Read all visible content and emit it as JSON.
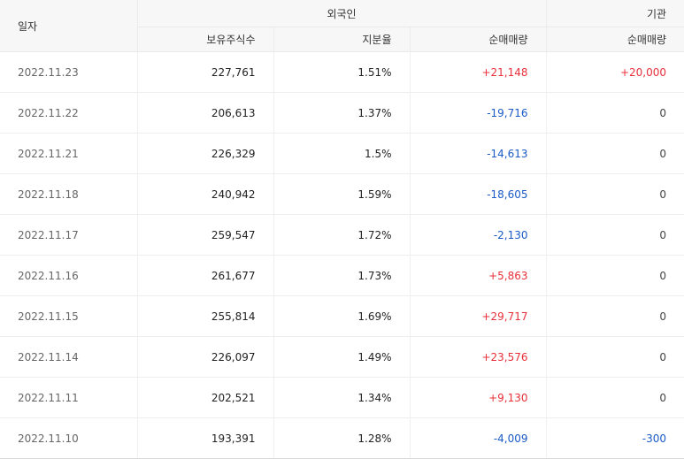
{
  "header": {
    "date": "일자",
    "foreign": "외국인",
    "institution": "기관",
    "holdings": "보유주식수",
    "share_ratio": "지분율",
    "foreign_net": "순매매량",
    "inst_net": "순매매량"
  },
  "colors": {
    "up": "#e8303a",
    "down": "#1a5bc6"
  },
  "rows": [
    {
      "date": "2022.11.23",
      "holdings": "227,761",
      "ratio": "1.51%",
      "foreign_net": "+21,148",
      "foreign_dir": "up",
      "inst_net": "+20,000",
      "inst_dir": "up"
    },
    {
      "date": "2022.11.22",
      "holdings": "206,613",
      "ratio": "1.37%",
      "foreign_net": "-19,716",
      "foreign_dir": "down",
      "inst_net": "0",
      "inst_dir": "zero"
    },
    {
      "date": "2022.11.21",
      "holdings": "226,329",
      "ratio": "1.5%",
      "foreign_net": "-14,613",
      "foreign_dir": "down",
      "inst_net": "0",
      "inst_dir": "zero"
    },
    {
      "date": "2022.11.18",
      "holdings": "240,942",
      "ratio": "1.59%",
      "foreign_net": "-18,605",
      "foreign_dir": "down",
      "inst_net": "0",
      "inst_dir": "zero"
    },
    {
      "date": "2022.11.17",
      "holdings": "259,547",
      "ratio": "1.72%",
      "foreign_net": "-2,130",
      "foreign_dir": "down",
      "inst_net": "0",
      "inst_dir": "zero"
    },
    {
      "date": "2022.11.16",
      "holdings": "261,677",
      "ratio": "1.73%",
      "foreign_net": "+5,863",
      "foreign_dir": "up",
      "inst_net": "0",
      "inst_dir": "zero"
    },
    {
      "date": "2022.11.15",
      "holdings": "255,814",
      "ratio": "1.69%",
      "foreign_net": "+29,717",
      "foreign_dir": "up",
      "inst_net": "0",
      "inst_dir": "zero"
    },
    {
      "date": "2022.11.14",
      "holdings": "226,097",
      "ratio": "1.49%",
      "foreign_net": "+23,576",
      "foreign_dir": "up",
      "inst_net": "0",
      "inst_dir": "zero"
    },
    {
      "date": "2022.11.11",
      "holdings": "202,521",
      "ratio": "1.34%",
      "foreign_net": "+9,130",
      "foreign_dir": "up",
      "inst_net": "0",
      "inst_dir": "zero"
    },
    {
      "date": "2022.11.10",
      "holdings": "193,391",
      "ratio": "1.28%",
      "foreign_net": "-4,009",
      "foreign_dir": "down",
      "inst_net": "-300",
      "inst_dir": "down"
    }
  ]
}
